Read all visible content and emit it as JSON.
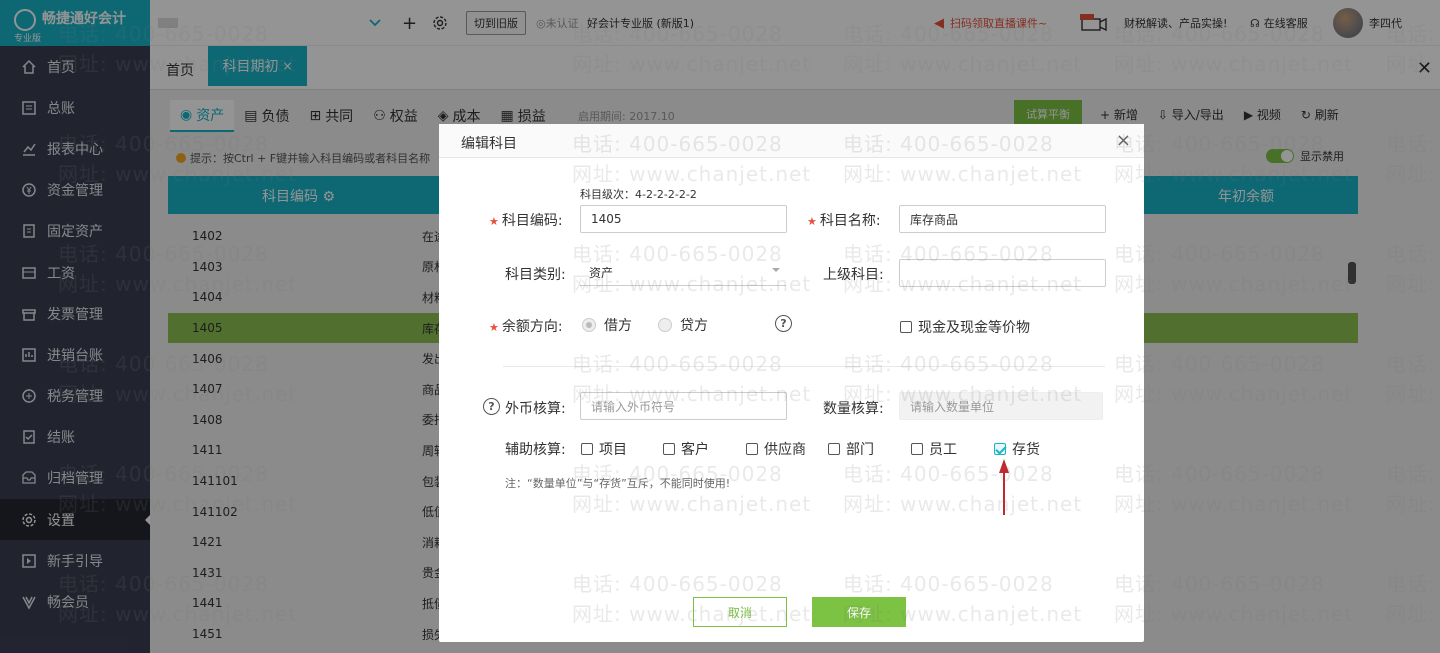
{
  "app": {
    "logo_text": "畅捷通好会计",
    "logo_sub": "专业版"
  },
  "sidebar": {
    "items": [
      {
        "label": "首页",
        "icon": "home-icon"
      },
      {
        "label": "总账",
        "icon": "ledger-icon"
      },
      {
        "label": "报表中心",
        "icon": "chart-icon"
      },
      {
        "label": "资金管理",
        "icon": "money-icon"
      },
      {
        "label": "固定资产",
        "icon": "asset-icon"
      },
      {
        "label": "工资",
        "icon": "wallet-icon"
      },
      {
        "label": "发票管理",
        "icon": "invoice-icon"
      },
      {
        "label": "进销台账",
        "icon": "inventory-icon"
      },
      {
        "label": "税务管理",
        "icon": "tax-icon"
      },
      {
        "label": "结账",
        "icon": "checkout-icon"
      },
      {
        "label": "归档管理",
        "icon": "archive-icon"
      },
      {
        "label": "设置",
        "icon": "gear-icon",
        "active": true
      },
      {
        "label": "新手引导",
        "icon": "guide-icon"
      },
      {
        "label": "畅会员",
        "icon": "member-icon"
      }
    ]
  },
  "topbar": {
    "switch_old": "切到旧版",
    "unverified": "未认证",
    "product": "好会计专业版 (新版1)",
    "promo": "扫码领取直播课件~",
    "news": "财税解读、产品实操!",
    "service": "在线客服",
    "user": "李四代"
  },
  "tabs": {
    "home": "首页",
    "active": "科目期初"
  },
  "page": {
    "cat_tabs": [
      "资产",
      "负债",
      "共同",
      "权益",
      "成本",
      "损益"
    ],
    "period": "启用期间: 2017.10",
    "trial": "试算平衡",
    "toolbar": [
      "新增",
      "导入/导出",
      "视频",
      "刷新"
    ],
    "hint": "提示：按Ctrl + F键并输入科目编码或者科目名称",
    "show_disabled": "显示禁用",
    "col_code": "科目编码",
    "col_balance": "年初余额",
    "rows": [
      {
        "code": "1402",
        "name": "在途"
      },
      {
        "code": "1403",
        "name": "原材"
      },
      {
        "code": "1404",
        "name": "材料"
      },
      {
        "code": "1405",
        "name": "库存",
        "selected": true
      },
      {
        "code": "1406",
        "name": "发出"
      },
      {
        "code": "1407",
        "name": "商品"
      },
      {
        "code": "1408",
        "name": "委托"
      },
      {
        "code": "1411",
        "name": "周转"
      },
      {
        "code": "141101",
        "name": "包装"
      },
      {
        "code": "141102",
        "name": "低值"
      },
      {
        "code": "1421",
        "name": "消耗"
      },
      {
        "code": "1431",
        "name": "贵金"
      },
      {
        "code": "1441",
        "name": "抵债"
      },
      {
        "code": "1451",
        "name": "损失"
      }
    ]
  },
  "modal": {
    "title": "编辑科目",
    "level": "科目级次：4-2-2-2-2-2",
    "code_label": "科目编码:",
    "code_value": "1405",
    "name_label": "科目名称:",
    "name_value": "库存商品",
    "type_label": "科目类别:",
    "type_value": "资产",
    "parent_label": "上级科目:",
    "parent_value": "",
    "direction_label": "余额方向:",
    "debit": "借方",
    "credit": "贷方",
    "cash": "现金及现金等价物",
    "foreign_label": "外币核算:",
    "foreign_placeholder": "请输入外币符号",
    "qty_label": "数量核算:",
    "qty_placeholder": "请输入数量单位",
    "aux_label": "辅助核算:",
    "aux": [
      {
        "label": "项目",
        "checked": false
      },
      {
        "label": "客户",
        "checked": false
      },
      {
        "label": "供应商",
        "checked": false
      },
      {
        "label": "部门",
        "checked": false
      },
      {
        "label": "员工",
        "checked": false
      },
      {
        "label": "存货",
        "checked": true
      }
    ],
    "note": "注：“数量单位”与“存货”互斥，不能同时使用!",
    "cancel": "取消",
    "save": "保存"
  },
  "watermark": {
    "phone": "电话: 400-665-0028",
    "site": "网址: www.chanjet.net"
  },
  "colors": {
    "brand": "#18b4c8",
    "green": "#7cc243",
    "sidebar": "#3a3f51",
    "required": "#e6503c"
  }
}
